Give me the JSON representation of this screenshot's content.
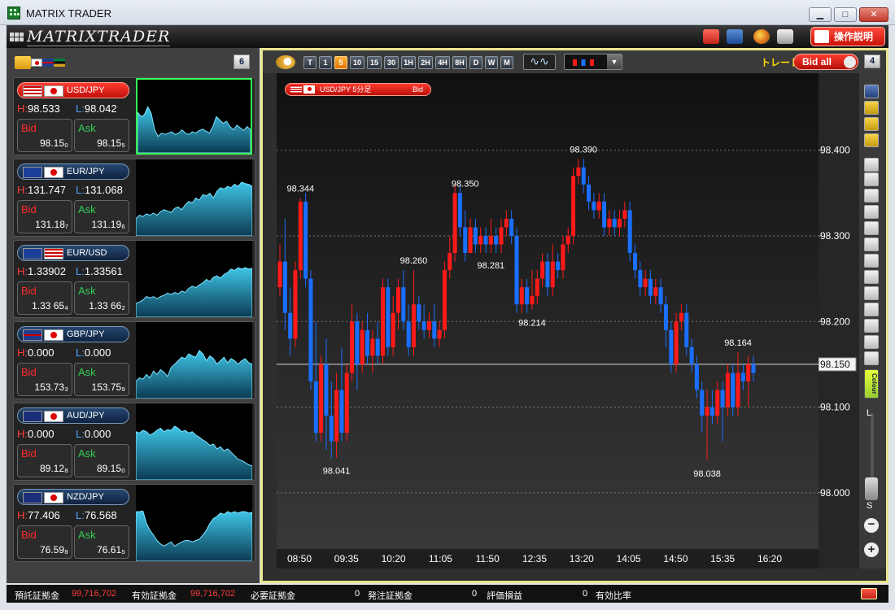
{
  "window": {
    "title": "MATRIX TRADER",
    "minimize": "▁",
    "maximize": "□",
    "close": "✕"
  },
  "toolbar": {
    "logo": "MATRIXTRADER",
    "help_label": "操作説明"
  },
  "left_panel": {
    "count": "6"
  },
  "pairs": [
    {
      "name": "USD/JPY",
      "active": true,
      "high_label": "H:",
      "high": "98.533",
      "low_label": "L:",
      "low": "98.042",
      "bid_label": "Bid",
      "bid_value": "98.15₀",
      "ask_label": "Ask",
      "ask_value": "98.15₅",
      "spark": [
        0.62,
        0.55,
        0.58,
        0.7,
        0.6,
        0.35,
        0.25,
        0.3,
        0.28,
        0.3,
        0.32,
        0.28,
        0.3,
        0.35,
        0.3,
        0.28,
        0.32,
        0.3,
        0.34,
        0.36,
        0.33,
        0.3,
        0.4,
        0.55,
        0.5,
        0.45,
        0.48,
        0.4,
        0.35,
        0.42,
        0.38,
        0.34,
        0.4,
        0.35
      ]
    },
    {
      "name": "EUR/JPY",
      "active": false,
      "high_label": "H:",
      "high": "131.747",
      "low_label": "L:",
      "low": "131.068",
      "bid_label": "Bid",
      "bid_value": "131.18₇",
      "ask_label": "Ask",
      "ask_value": "131.19₆",
      "spark": [
        0.25,
        0.3,
        0.28,
        0.32,
        0.3,
        0.33,
        0.3,
        0.35,
        0.38,
        0.36,
        0.34,
        0.4,
        0.42,
        0.38,
        0.45,
        0.5,
        0.48,
        0.55,
        0.52,
        0.6,
        0.58,
        0.62,
        0.55,
        0.65,
        0.7,
        0.68,
        0.72,
        0.7,
        0.75,
        0.72,
        0.78,
        0.76,
        0.75,
        0.72
      ]
    },
    {
      "name": "EUR/USD",
      "active": false,
      "high_label": "H:",
      "high": "1.33902",
      "low_label": "L:",
      "low": "1.33561",
      "bid_label": "Bid",
      "bid_value": "1.33 65₄",
      "ask_label": "Ask",
      "ask_value": "1.33 66₂",
      "spark": [
        0.2,
        0.22,
        0.25,
        0.3,
        0.28,
        0.3,
        0.27,
        0.3,
        0.32,
        0.35,
        0.33,
        0.36,
        0.34,
        0.38,
        0.36,
        0.42,
        0.45,
        0.43,
        0.47,
        0.5,
        0.55,
        0.52,
        0.58,
        0.6,
        0.57,
        0.62,
        0.65,
        0.7,
        0.68,
        0.72,
        0.7,
        0.72,
        0.7,
        0.71
      ]
    },
    {
      "name": "GBP/JPY",
      "active": false,
      "high_label": "H:",
      "high": "0.000",
      "low_label": "L:",
      "low": "0.000",
      "bid_label": "Bid",
      "bid_value": "153.73₃",
      "ask_label": "Ask",
      "ask_value": "153.75₉",
      "spark": [
        0.25,
        0.3,
        0.28,
        0.35,
        0.3,
        0.4,
        0.35,
        0.42,
        0.38,
        0.32,
        0.45,
        0.5,
        0.55,
        0.6,
        0.58,
        0.65,
        0.62,
        0.6,
        0.7,
        0.65,
        0.55,
        0.62,
        0.58,
        0.5,
        0.55,
        0.6,
        0.52,
        0.58,
        0.55,
        0.5,
        0.55,
        0.58,
        0.52,
        0.5
      ]
    },
    {
      "name": "AUD/JPY",
      "active": false,
      "high_label": "H:",
      "high": "0.000",
      "low_label": "L:",
      "low": "0.000",
      "bid_label": "Bid",
      "bid_value": "89.12₈",
      "ask_label": "Ask",
      "ask_value": "89.15₀",
      "spark": [
        0.7,
        0.68,
        0.72,
        0.7,
        0.65,
        0.68,
        0.72,
        0.75,
        0.7,
        0.73,
        0.72,
        0.78,
        0.75,
        0.7,
        0.72,
        0.68,
        0.7,
        0.65,
        0.62,
        0.58,
        0.55,
        0.5,
        0.52,
        0.45,
        0.48,
        0.42,
        0.45,
        0.4,
        0.35,
        0.3,
        0.28,
        0.25,
        0.22,
        0.2
      ]
    },
    {
      "name": "NZD/JPY",
      "active": false,
      "high_label": "H:",
      "high": "77.406",
      "low_label": "L:",
      "low": "76.568",
      "bid_label": "Bid",
      "bid_value": "76.59₈",
      "ask_label": "Ask",
      "ask_value": "76.61₅",
      "spark": [
        0.72,
        0.72,
        0.73,
        0.55,
        0.45,
        0.38,
        0.3,
        0.25,
        0.22,
        0.25,
        0.28,
        0.22,
        0.25,
        0.28,
        0.3,
        0.3,
        0.28,
        0.3,
        0.32,
        0.38,
        0.45,
        0.55,
        0.62,
        0.65,
        0.7,
        0.68,
        0.72,
        0.7,
        0.72,
        0.7,
        0.72,
        0.72,
        0.7,
        0.71
      ]
    }
  ],
  "chart": {
    "timeframes": [
      "T",
      "1",
      "5",
      "10",
      "15",
      "30",
      "1H",
      "2H",
      "4H",
      "8H",
      "D",
      "W",
      "M"
    ],
    "selected_timeframe": "5",
    "trade_label": "トレード",
    "bid_all_label": "Bid all",
    "count": "4",
    "series_label": "USD/JPY 5分足",
    "series_side": "Bid",
    "current_price": "98.150",
    "zoom_l": "L",
    "zoom_s": "S",
    "colour_label": "Colour"
  },
  "chart_data": {
    "type": "candlestick",
    "y_ticks": [
      "98.400",
      "98.300",
      "98.200",
      "98.100",
      "98.000"
    ],
    "y_tick_values": [
      98.4,
      98.3,
      98.2,
      98.1,
      98.0
    ],
    "ylim": [
      97.94,
      98.49
    ],
    "x_ticks": [
      "08:50",
      "09:35",
      "10:20",
      "11:05",
      "11:50",
      "12:35",
      "13:20",
      "14:05",
      "14:50",
      "15:35",
      "16:20"
    ],
    "annotations": [
      {
        "text": "98.344",
        "x": 4,
        "y": 98.344
      },
      {
        "text": "98.041",
        "x": 11,
        "y": 98.041
      },
      {
        "text": "98.260",
        "x": 26,
        "y": 98.26
      },
      {
        "text": "98.350",
        "x": 36,
        "y": 98.35
      },
      {
        "text": "98.281",
        "x": 41,
        "y": 98.281
      },
      {
        "text": "98.214",
        "x": 49,
        "y": 98.214
      },
      {
        "text": "98.390",
        "x": 59,
        "y": 98.39
      },
      {
        "text": "98.164",
        "x": 89,
        "y": 98.164
      },
      {
        "text": "98.038",
        "x": 83,
        "y": 98.038
      }
    ],
    "candles": [
      [
        98.24,
        98.27,
        98.29,
        98.23
      ],
      [
        98.27,
        98.21,
        98.32,
        98.19
      ],
      [
        98.21,
        98.18,
        98.24,
        98.16
      ],
      [
        98.18,
        98.26,
        98.27,
        98.17
      ],
      [
        98.26,
        98.34,
        98.344,
        98.25
      ],
      [
        98.34,
        98.25,
        98.35,
        98.24
      ],
      [
        98.25,
        98.13,
        98.26,
        98.12
      ],
      [
        98.13,
        98.07,
        98.2,
        98.06
      ],
      [
        98.07,
        98.15,
        98.16,
        98.06
      ],
      [
        98.15,
        98.09,
        98.18,
        98.05
      ],
      [
        98.09,
        98.06,
        98.13,
        98.04
      ],
      [
        98.06,
        98.12,
        98.14,
        98.041
      ],
      [
        98.12,
        98.07,
        98.17,
        98.06
      ],
      [
        98.07,
        98.14,
        98.15,
        98.06
      ],
      [
        98.14,
        98.2,
        98.22,
        98.13
      ],
      [
        98.2,
        98.15,
        98.21,
        98.12
      ],
      [
        98.15,
        98.19,
        98.2,
        98.14
      ],
      [
        98.19,
        98.16,
        98.21,
        98.15
      ],
      [
        98.16,
        98.18,
        98.19,
        98.14
      ],
      [
        98.18,
        98.16,
        98.2,
        98.15
      ],
      [
        98.16,
        98.24,
        98.25,
        98.15
      ],
      [
        98.24,
        98.17,
        98.25,
        98.16
      ],
      [
        98.17,
        98.21,
        98.23,
        98.16
      ],
      [
        98.21,
        98.24,
        98.25,
        98.19
      ],
      [
        98.24,
        98.2,
        98.26,
        98.19
      ],
      [
        98.2,
        98.17,
        98.22,
        98.16
      ],
      [
        98.17,
        98.22,
        98.26,
        98.16
      ],
      [
        98.22,
        98.2,
        98.23,
        98.19
      ],
      [
        98.2,
        98.19,
        98.22,
        98.18
      ],
      [
        98.19,
        98.2,
        98.21,
        98.18
      ],
      [
        98.2,
        98.18,
        98.22,
        98.17
      ],
      [
        98.18,
        98.19,
        98.2,
        98.17
      ],
      [
        98.19,
        98.26,
        98.27,
        98.18
      ],
      [
        98.26,
        98.28,
        98.3,
        98.25
      ],
      [
        98.28,
        98.35,
        98.36,
        98.27
      ],
      [
        98.35,
        98.31,
        98.36,
        98.3
      ],
      [
        98.31,
        98.28,
        98.33,
        98.27
      ],
      [
        98.28,
        98.31,
        98.32,
        98.28
      ],
      [
        98.31,
        98.29,
        98.32,
        98.28
      ],
      [
        98.29,
        98.3,
        98.31,
        98.28
      ],
      [
        98.3,
        98.29,
        98.31,
        98.28
      ],
      [
        98.29,
        98.3,
        98.32,
        98.28
      ],
      [
        98.3,
        98.29,
        98.31,
        98.28
      ],
      [
        98.29,
        98.31,
        98.32,
        98.28
      ],
      [
        98.31,
        98.32,
        98.33,
        98.3
      ],
      [
        98.32,
        98.3,
        98.33,
        98.29
      ],
      [
        98.3,
        98.22,
        98.31,
        98.21
      ],
      [
        98.22,
        98.24,
        98.25,
        98.21
      ],
      [
        98.24,
        98.22,
        98.25,
        98.21
      ],
      [
        98.22,
        98.23,
        98.26,
        98.214
      ],
      [
        98.23,
        98.25,
        98.26,
        98.22
      ],
      [
        98.25,
        98.27,
        98.28,
        98.24
      ],
      [
        98.27,
        98.24,
        98.28,
        98.23
      ],
      [
        98.24,
        98.27,
        98.29,
        98.23
      ],
      [
        98.27,
        98.26,
        98.28,
        98.25
      ],
      [
        98.26,
        98.29,
        98.3,
        98.25
      ],
      [
        98.29,
        98.3,
        98.31,
        98.28
      ],
      [
        98.3,
        98.37,
        98.38,
        98.29
      ],
      [
        98.37,
        98.38,
        98.39,
        98.36
      ],
      [
        98.38,
        98.36,
        98.39,
        98.35
      ],
      [
        98.36,
        98.34,
        98.37,
        98.33
      ],
      [
        98.34,
        98.33,
        98.35,
        98.32
      ],
      [
        98.33,
        98.34,
        98.35,
        98.32
      ],
      [
        98.34,
        98.31,
        98.35,
        98.3
      ],
      [
        98.31,
        98.32,
        98.33,
        98.3
      ],
      [
        98.32,
        98.31,
        98.33,
        98.3
      ],
      [
        98.31,
        98.32,
        98.33,
        98.3
      ],
      [
        98.32,
        98.33,
        98.34,
        98.31
      ],
      [
        98.33,
        98.28,
        98.34,
        98.27
      ],
      [
        98.28,
        98.26,
        98.29,
        98.25
      ],
      [
        98.26,
        98.24,
        98.27,
        98.23
      ],
      [
        98.24,
        98.25,
        98.26,
        98.23
      ],
      [
        98.25,
        98.23,
        98.26,
        98.22
      ],
      [
        98.23,
        98.24,
        98.25,
        98.22
      ],
      [
        98.24,
        98.22,
        98.25,
        98.21
      ],
      [
        98.22,
        98.19,
        98.23,
        98.17
      ],
      [
        98.19,
        98.15,
        98.2,
        98.14
      ],
      [
        98.15,
        98.2,
        98.21,
        98.14
      ],
      [
        98.2,
        98.21,
        98.22,
        98.19
      ],
      [
        98.21,
        98.17,
        98.22,
        98.16
      ],
      [
        98.17,
        98.15,
        98.18,
        98.14
      ],
      [
        98.15,
        98.12,
        98.16,
        98.11
      ],
      [
        98.12,
        98.09,
        98.13,
        98.07
      ],
      [
        98.09,
        98.1,
        98.12,
        98.038
      ],
      [
        98.1,
        98.09,
        98.12,
        98.08
      ],
      [
        98.09,
        98.12,
        98.13,
        98.08
      ],
      [
        98.12,
        98.1,
        98.13,
        98.06
      ],
      [
        98.1,
        98.14,
        98.15,
        98.09
      ],
      [
        98.14,
        98.1,
        98.15,
        98.09
      ],
      [
        98.1,
        98.14,
        98.164,
        98.09
      ],
      [
        98.14,
        98.13,
        98.15,
        98.12
      ],
      [
        98.13,
        98.15,
        98.16,
        98.1
      ],
      [
        98.15,
        98.14,
        98.16,
        98.13
      ]
    ]
  },
  "status": {
    "deposit_label": "預託証拠金",
    "deposit_value": "99,716,702",
    "effective_label": "有効証拠金",
    "effective_value": "99,716,702",
    "required_label": "必要証拠金",
    "required_value": "0",
    "order_label": "発注証拠金",
    "order_value": "0",
    "pl_label": "評価損益",
    "pl_value": "0",
    "ratio_label": "有効比率"
  },
  "colors": {
    "bull": "#ff1a1a",
    "bear": "#1a6fff",
    "accent": "#ebe48f",
    "spark_fill": "#1e8fb0"
  }
}
